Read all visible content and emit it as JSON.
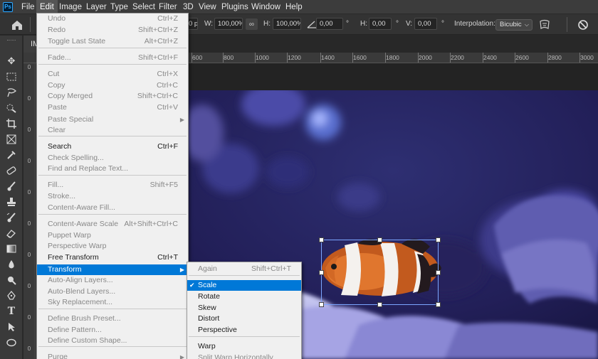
{
  "menubar": {
    "logo": "Ps",
    "items": [
      "File",
      "Edit",
      "Image",
      "Layer",
      "Type",
      "Select",
      "Filter",
      "3D",
      "View",
      "Plugins",
      "Window",
      "Help"
    ],
    "active": "Edit"
  },
  "options_bar": {
    "x_partial": "0 p",
    "w_label": "W:",
    "w_value": "100,00%",
    "h_label": "H:",
    "h_value": "100,00%",
    "angle_value": "0,00",
    "angle_unit": "°",
    "hskew_label": "H:",
    "hskew_value": "0,00",
    "hskew_unit": "°",
    "vskew_label": "V:",
    "vskew_value": "0,00",
    "vskew_unit": "°",
    "interpolation_label": "Interpolation:",
    "interpolation_value": "Bicubic"
  },
  "document": {
    "tab_partial": "IM"
  },
  "ruler": {
    "h_labels": [
      "600",
      "800",
      "1000",
      "1200",
      "1400",
      "1600",
      "1800",
      "2000",
      "2200",
      "2400",
      "2600",
      "2800",
      "3000"
    ],
    "v_labels": [
      "0",
      "0",
      "0",
      "0",
      "0",
      "0",
      "0",
      "0",
      "0",
      "0"
    ]
  },
  "edit_menu": {
    "items": [
      {
        "label": "Undo",
        "shortcut": "Ctrl+Z",
        "enabled": false
      },
      {
        "label": "Redo",
        "shortcut": "Shift+Ctrl+Z",
        "enabled": false
      },
      {
        "label": "Toggle Last State",
        "shortcut": "Alt+Ctrl+Z",
        "enabled": false
      },
      {
        "label": "Fade...",
        "shortcut": "Shift+Ctrl+F",
        "enabled": false
      },
      {
        "label": "Cut",
        "shortcut": "Ctrl+X",
        "enabled": false
      },
      {
        "label": "Copy",
        "shortcut": "Ctrl+C",
        "enabled": false
      },
      {
        "label": "Copy Merged",
        "shortcut": "Shift+Ctrl+C",
        "enabled": false
      },
      {
        "label": "Paste",
        "shortcut": "Ctrl+V",
        "enabled": false
      },
      {
        "label": "Paste Special",
        "shortcut": "",
        "enabled": false,
        "submenu": true
      },
      {
        "label": "Clear",
        "shortcut": "",
        "enabled": false
      },
      {
        "label": "Search",
        "shortcut": "Ctrl+F",
        "enabled": true
      },
      {
        "label": "Check Spelling...",
        "shortcut": "",
        "enabled": false
      },
      {
        "label": "Find and Replace Text...",
        "shortcut": "",
        "enabled": false
      },
      {
        "label": "Fill...",
        "shortcut": "Shift+F5",
        "enabled": false
      },
      {
        "label": "Stroke...",
        "shortcut": "",
        "enabled": false
      },
      {
        "label": "Content-Aware Fill...",
        "shortcut": "",
        "enabled": false
      },
      {
        "label": "Content-Aware Scale",
        "shortcut": "Alt+Shift+Ctrl+C",
        "enabled": false
      },
      {
        "label": "Puppet Warp",
        "shortcut": "",
        "enabled": false
      },
      {
        "label": "Perspective Warp",
        "shortcut": "",
        "enabled": false
      },
      {
        "label": "Free Transform",
        "shortcut": "Ctrl+T",
        "enabled": true
      },
      {
        "label": "Transform",
        "shortcut": "",
        "enabled": true,
        "submenu": true,
        "highlighted": true
      },
      {
        "label": "Auto-Align Layers...",
        "shortcut": "",
        "enabled": false
      },
      {
        "label": "Auto-Blend Layers...",
        "shortcut": "",
        "enabled": false
      },
      {
        "label": "Sky Replacement...",
        "shortcut": "",
        "enabled": false
      },
      {
        "label": "Define Brush Preset...",
        "shortcut": "",
        "enabled": false
      },
      {
        "label": "Define Pattern...",
        "shortcut": "",
        "enabled": false
      },
      {
        "label": "Define Custom Shape...",
        "shortcut": "",
        "enabled": false
      },
      {
        "label": "Purge",
        "shortcut": "",
        "enabled": false,
        "submenu": true
      }
    ]
  },
  "transform_submenu": {
    "items": [
      {
        "label": "Again",
        "shortcut": "Shift+Ctrl+T",
        "enabled": false
      },
      {
        "label": "Scale",
        "shortcut": "",
        "enabled": true,
        "checked": true,
        "highlighted": true
      },
      {
        "label": "Rotate",
        "shortcut": "",
        "enabled": true
      },
      {
        "label": "Skew",
        "shortcut": "",
        "enabled": true
      },
      {
        "label": "Distort",
        "shortcut": "",
        "enabled": true
      },
      {
        "label": "Perspective",
        "shortcut": "",
        "enabled": true
      },
      {
        "label": "Warp",
        "shortcut": "",
        "enabled": true
      },
      {
        "label": "Split Warp Horizontally",
        "shortcut": "",
        "enabled": false
      }
    ]
  },
  "toolbar": {
    "tools": [
      "move-tool",
      "marquee-tool",
      "lasso-tool",
      "quick-selection-tool",
      "crop-tool",
      "frame-tool",
      "eyedropper-tool",
      "healing-brush-tool",
      "brush-tool",
      "clone-stamp-tool",
      "history-brush-tool",
      "eraser-tool",
      "gradient-tool",
      "blur-tool",
      "dodge-tool",
      "pen-tool",
      "type-tool",
      "path-selection-tool",
      "shape-tool"
    ]
  }
}
